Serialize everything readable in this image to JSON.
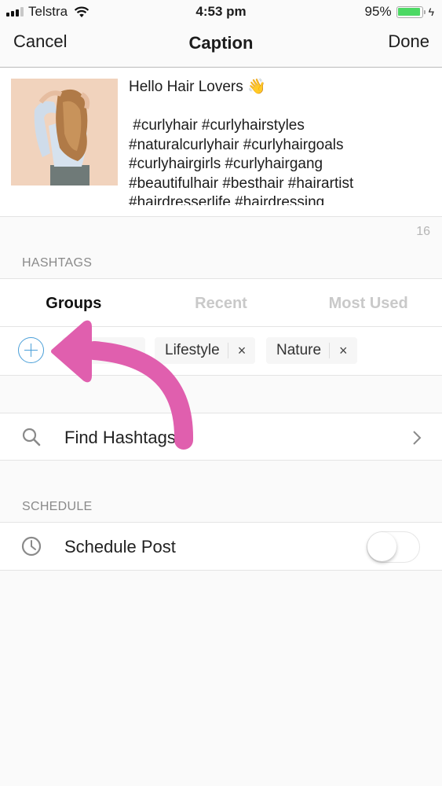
{
  "status_bar": {
    "carrier": "Telstra",
    "time": "4:53 pm",
    "battery_percent_label": "95%",
    "battery_level": 0.95,
    "signal_bars_active": 3,
    "signal_bars_total": 4
  },
  "nav": {
    "cancel_label": "Cancel",
    "title": "Caption",
    "done_label": "Done"
  },
  "caption": {
    "text": "Hello Hair Lovers 👋\n\n #curlyhair #curlyhairstyles\n#naturalcurlyhair #curlyhairgoals\n#curlyhairgirls #curlyhairgang\n#beautifulhair #besthair #hairartist\n#hairdresserlife #hairdressing",
    "char_remaining": "16"
  },
  "hashtags": {
    "section_title": "HASHTAGS",
    "tabs": [
      {
        "label": "Groups",
        "active": true
      },
      {
        "label": "Recent",
        "active": false
      },
      {
        "label": "Most Used",
        "active": false
      }
    ],
    "groups": [
      {
        "label": "Lifestyle"
      },
      {
        "label": "Nature"
      }
    ],
    "remove_glyph": "×",
    "find_label": "Find Hashtags"
  },
  "schedule": {
    "section_title": "SCHEDULE",
    "row_label": "Schedule Post",
    "enabled": false
  },
  "colors": {
    "accent_blue": "#4a9fd8",
    "annotation_pink": "#e05fae",
    "battery_green": "#4cd964"
  }
}
